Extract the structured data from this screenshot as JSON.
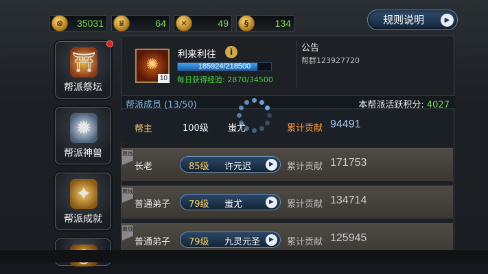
{
  "currencies": [
    {
      "icon": "gold-coin-icon",
      "value": "35031"
    },
    {
      "icon": "helmet-icon",
      "value": "64"
    },
    {
      "icon": "crossed-swords-icon",
      "value": "49"
    },
    {
      "icon": "scroll-icon",
      "value": "134"
    }
  ],
  "rules_button": {
    "label": "规则说明"
  },
  "sidebar": {
    "items": [
      {
        "label": "帮派祭坛",
        "icon": "altar-icon",
        "badge": true
      },
      {
        "label": "帮派神兽",
        "icon": "beast-icon",
        "badge": false
      },
      {
        "label": "帮派成就",
        "icon": "achievement-icon",
        "badge": false
      },
      {
        "label": "",
        "icon": "money-bag-icon",
        "badge": false
      }
    ]
  },
  "guild": {
    "name": "利来利往",
    "level": "10",
    "exp_text": "185924/218500",
    "exp_progress": 0.851,
    "daily_exp": "每日获得经验: 2870/34500"
  },
  "notice": {
    "title": "公告",
    "text": "帮群123927720"
  },
  "members_header": {
    "title": "帮派成员 (13/50)",
    "activity_label": "本帮派活跃积分:",
    "activity_value": "4027"
  },
  "members": [
    {
      "role": "帮主",
      "level": "100级",
      "name": "蚩尤",
      "contrib_label": "累计贡献",
      "contrib": "94491",
      "leader": true
    },
    {
      "role": "长老",
      "level": "85级",
      "name": "许元迟",
      "contrib_label": "累计贡献",
      "contrib": "171753",
      "offline": "离线"
    },
    {
      "role": "普通弟子",
      "level": "79级",
      "name": "蚩尤",
      "contrib_label": "累计贡献",
      "contrib": "134714",
      "offline": "离线"
    },
    {
      "role": "普通弟子",
      "level": "79级",
      "name": "九灵元圣",
      "contrib_label": "累计贡献",
      "contrib": "125945",
      "offline": "离线"
    }
  ],
  "colors": {
    "accent_green": "#7ddc56",
    "accent_blue": "#7cb7e8",
    "leader_orange": "#ff9a3a"
  }
}
